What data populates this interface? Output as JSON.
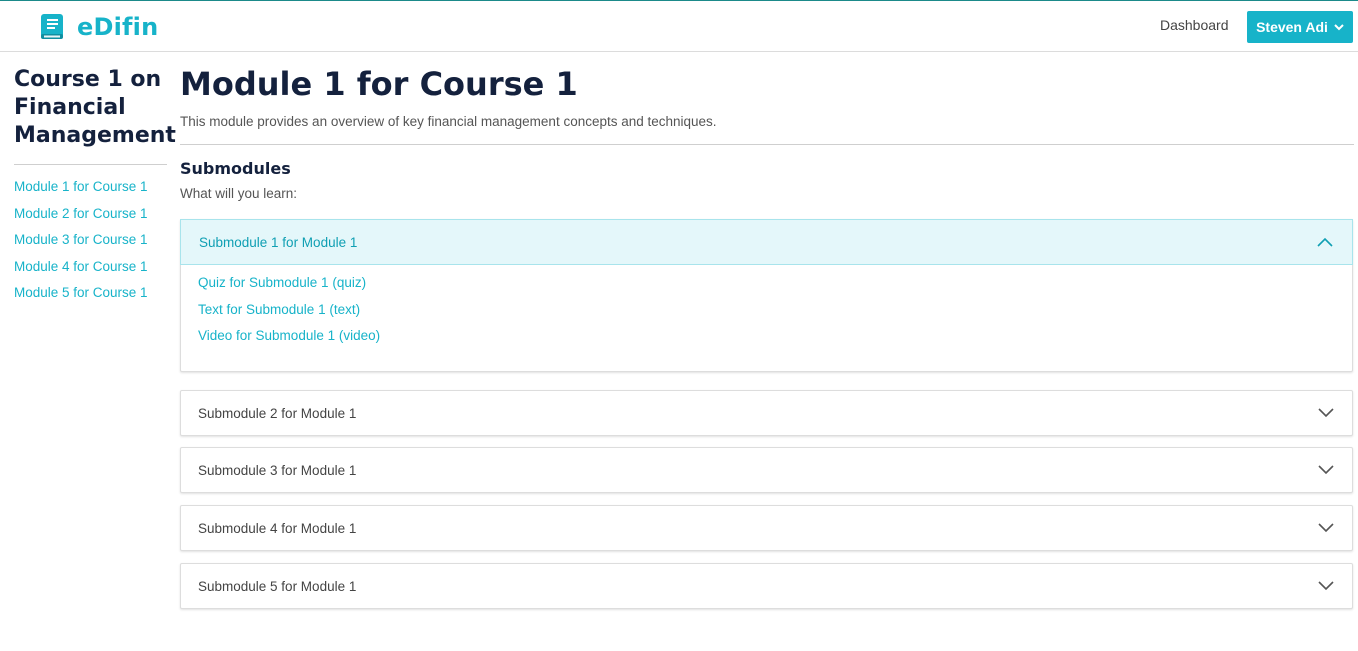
{
  "brand": {
    "name": "eDifin",
    "icon": "book-icon",
    "color": "#17b3c9"
  },
  "nav": {
    "dashboard_label": "Dashboard",
    "user_label": "Steven Adi",
    "user_icon": "chevron-down-icon"
  },
  "sidebar": {
    "course_title": "Course 1 on Financial Management",
    "items": [
      {
        "label": "Module 1 for Course 1"
      },
      {
        "label": "Module 2 for Course 1"
      },
      {
        "label": "Module 3 for Course 1"
      },
      {
        "label": "Module 4 for Course 1"
      },
      {
        "label": "Module 5 for Course 1"
      }
    ]
  },
  "main": {
    "title": "Module 1 for Course 1",
    "description": "This module provides an overview of key financial management concepts and techniques.",
    "section_title": "Submodules",
    "section_subtitle": "What will you learn:"
  },
  "submodules": [
    {
      "label": "Submodule 1 for Module 1",
      "expanded": true,
      "items": [
        {
          "label": "Quiz for Submodule 1 (quiz)"
        },
        {
          "label": "Text for Submodule 1 (text)"
        },
        {
          "label": "Video for Submodule 1 (video)"
        }
      ]
    },
    {
      "label": "Submodule 2 for Module 1",
      "expanded": false
    },
    {
      "label": "Submodule 3 for Module 1",
      "expanded": false
    },
    {
      "label": "Submodule 4 for Module 1",
      "expanded": false
    },
    {
      "label": "Submodule 5 for Module 1",
      "expanded": false
    }
  ],
  "colors": {
    "accent": "#17b3c9",
    "heading": "#14213d",
    "expanded_bg": "#e4f7fa"
  }
}
